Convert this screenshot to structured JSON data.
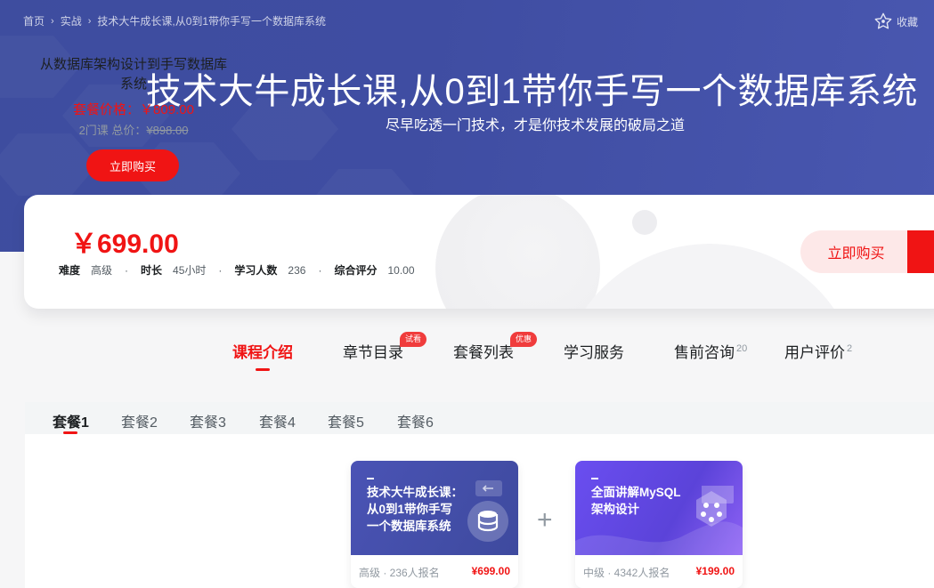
{
  "breadcrumb": {
    "items": [
      "首页",
      "实战",
      "技术大牛成长课,从0到1带你手写一个数据库系统"
    ]
  },
  "favorite_label": "收藏",
  "hero": {
    "title": "技术大牛成长课,从0到1带你手写一个数据库系统",
    "subtitle": "尽早吃透一门技术，才是你技术发展的破局之道"
  },
  "course": {
    "price": "￥699.00",
    "meta": [
      {
        "label": "难度",
        "value": "高级"
      },
      {
        "label": "时长",
        "value": "45小时"
      },
      {
        "label": "学习人数",
        "value": "236"
      },
      {
        "label": "综合评分",
        "value": "10.00"
      }
    ],
    "buy_label": "立即购买"
  },
  "nav_tabs": [
    {
      "label": "课程介绍",
      "active": true
    },
    {
      "label": "章节目录",
      "badge": "试看"
    },
    {
      "label": "套餐列表",
      "badge": "优惠"
    },
    {
      "label": "学习服务"
    },
    {
      "label": "售前咨询",
      "count": "20"
    },
    {
      "label": "用户评价",
      "count": "2"
    }
  ],
  "packages": {
    "tabs": [
      "套餐1",
      "套餐2",
      "套餐3",
      "套餐4",
      "套餐5",
      "套餐6"
    ],
    "active_index": 0,
    "name": "从数据库架构设计到手写数据库系统",
    "price": "套餐价格：￥809.00",
    "count": "2门课",
    "original_prefix": "总价：",
    "original_price": "¥898.00",
    "buy_label": "立即购买",
    "plus": "+",
    "courses": [
      {
        "cover_title": "技术大牛成长课：\n从0到1带你手写\n一个数据库系统",
        "level": "高级 · 236人报名",
        "price": "¥699.00"
      },
      {
        "cover_title": "全面讲解MySQL\n架构设计",
        "level": "中级 · 4342人报名",
        "price": "¥199.00"
      }
    ]
  },
  "colors": {
    "accent": "#f01414",
    "hero_bg": "#3f4da2",
    "badge": "#f03c3c"
  },
  "icons": {
    "favorite": "star-icon"
  }
}
